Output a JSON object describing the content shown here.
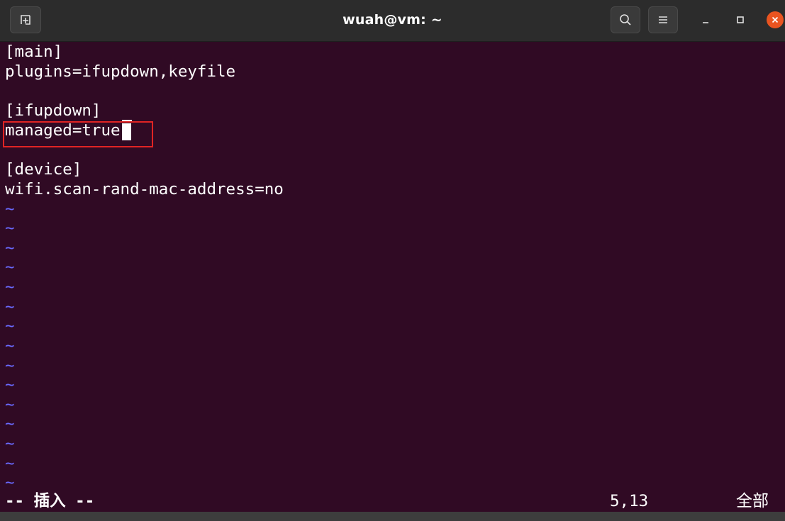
{
  "window": {
    "title": "wuah@vm: ~"
  },
  "icons": {
    "new_tab": "new-tab-icon",
    "search": "search-icon",
    "menu": "hamburger-menu-icon",
    "minimize": "minimize-icon",
    "maximize": "maximize-icon",
    "close": "close-icon"
  },
  "colors": {
    "terminal_bg": "#300a24",
    "titlebar_bg": "#2c2c2c",
    "close_accent": "#e95420",
    "tilde": "#6a6aff",
    "highlight": "#e02424"
  },
  "editor": {
    "lines": [
      "[main]",
      "plugins=ifupdown,keyfile",
      "",
      "[ifupdown]",
      "managed=true",
      "",
      "[device]",
      "wifi.scan-rand-mac-address=no"
    ],
    "empty_marker": "~"
  },
  "statusline": {
    "mode": "-- 插入 --",
    "position": "5,13",
    "scroll": "全部"
  }
}
